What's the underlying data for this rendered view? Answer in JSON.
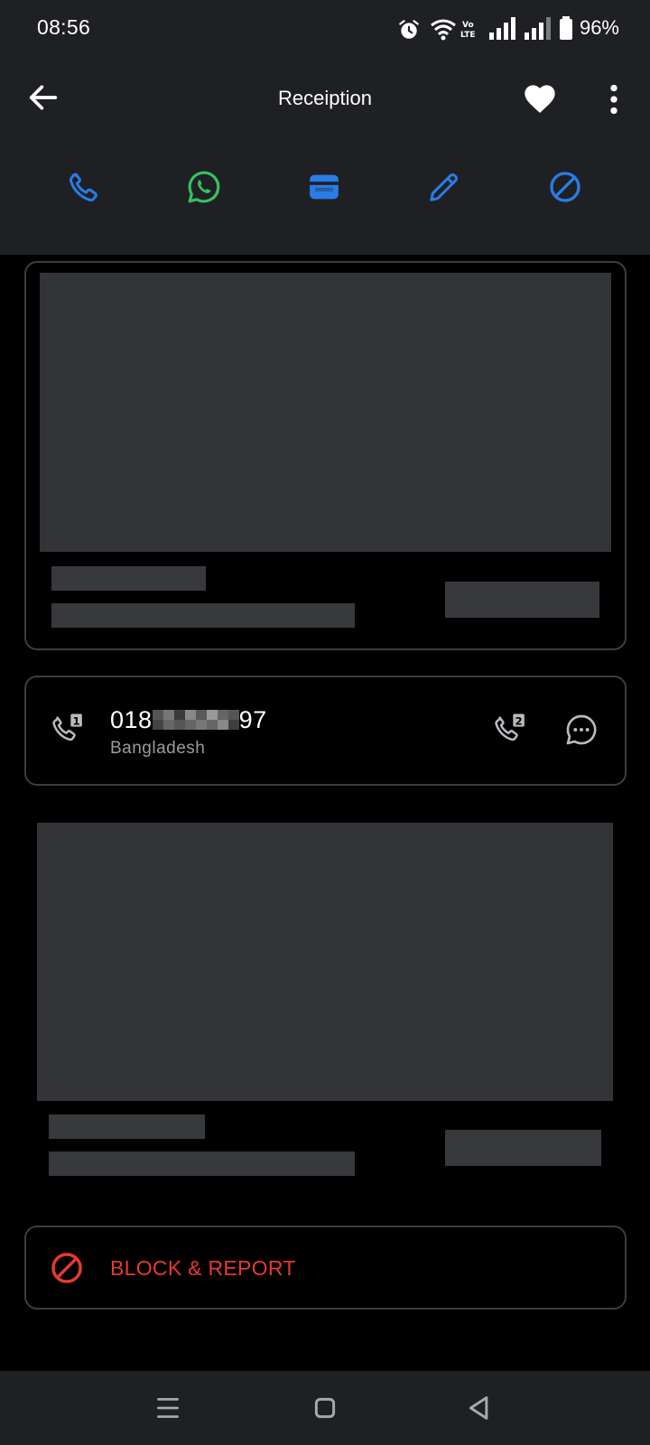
{
  "status_bar": {
    "time": "08:56",
    "battery": "96%",
    "icons": [
      "alarm-icon",
      "wifi-icon",
      "volte-icon",
      "signal-sim1-icon",
      "signal-sim2-icon",
      "battery-icon"
    ]
  },
  "app_bar": {
    "title": "Receiption",
    "icons": [
      "back-arrow-icon",
      "heart-icon",
      "more-vert-icon"
    ]
  },
  "actions": [
    {
      "name": "call",
      "icon": "phone-icon",
      "color": "#2a7ce6"
    },
    {
      "name": "whatsapp",
      "icon": "whatsapp-icon",
      "color": "#35c25e"
    },
    {
      "name": "wallet",
      "icon": "wallet-icon",
      "color": "#2a7ce6"
    },
    {
      "name": "edit",
      "icon": "pencil-icon",
      "color": "#2a7ce6"
    },
    {
      "name": "block",
      "icon": "block-icon",
      "color": "#2a7ce6"
    }
  ],
  "phone": {
    "prefix": "018",
    "suffix": "97",
    "country": "Bangladesh",
    "sim1_label": "1",
    "sim2_label": "2"
  },
  "block_report": {
    "label": "BLOCK & REPORT",
    "color": "#e53a2f"
  },
  "colors": {
    "header_bg": "#1f2024",
    "page_bg": "#000000",
    "placeholder": "#333437",
    "accent_blue": "#2a7ce6"
  }
}
